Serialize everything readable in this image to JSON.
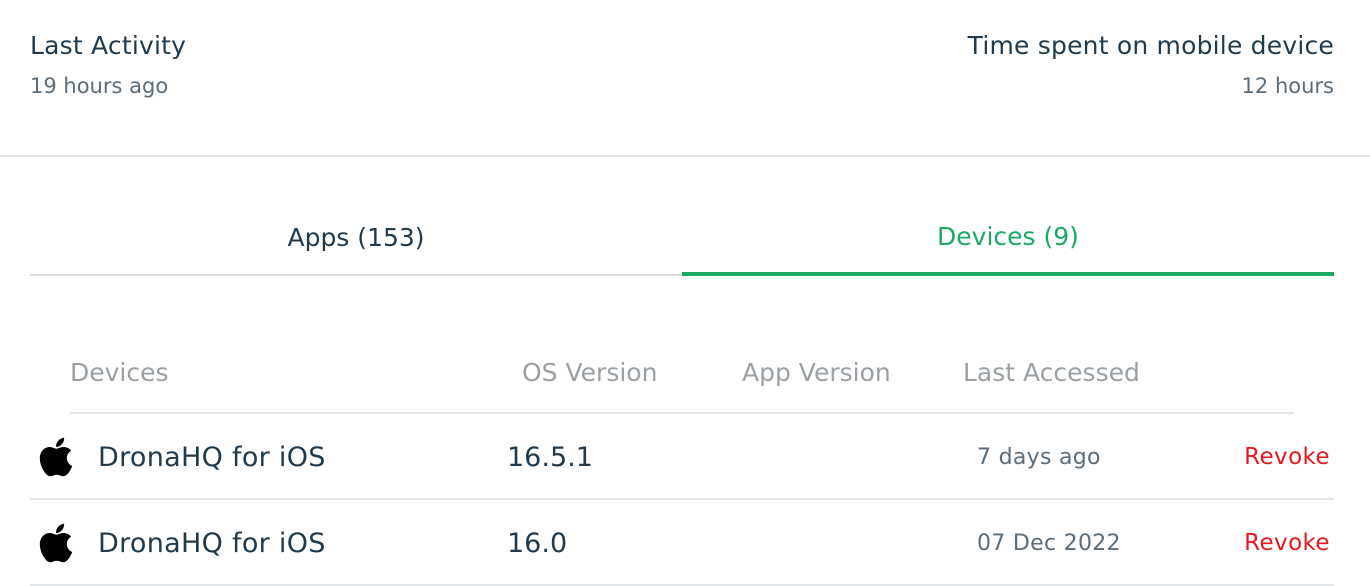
{
  "stats": {
    "last_activity": {
      "label": "Last Activity",
      "value": "19 hours ago"
    },
    "time_spent": {
      "label": "Time spent on mobile device",
      "value": "12 hours"
    }
  },
  "tabs": [
    {
      "label": "Apps (153)",
      "active": false
    },
    {
      "label": "Devices (9)",
      "active": true
    }
  ],
  "colors": {
    "accent": "#1aaa62",
    "danger": "#e5191f",
    "text": "#1f3a4d",
    "muted": "#9aa0a4"
  },
  "table": {
    "columns": [
      "Devices",
      "OS Version",
      "App Version",
      "Last Accessed"
    ],
    "rows": [
      {
        "icon": "apple-icon",
        "device": "DronaHQ for iOS",
        "os_version": "16.5.1",
        "app_version": "",
        "last_accessed": "7 days ago",
        "action": "Revoke"
      },
      {
        "icon": "apple-icon",
        "device": "DronaHQ for iOS",
        "os_version": "16.0",
        "app_version": "",
        "last_accessed": "07 Dec 2022",
        "action": "Revoke"
      }
    ]
  }
}
